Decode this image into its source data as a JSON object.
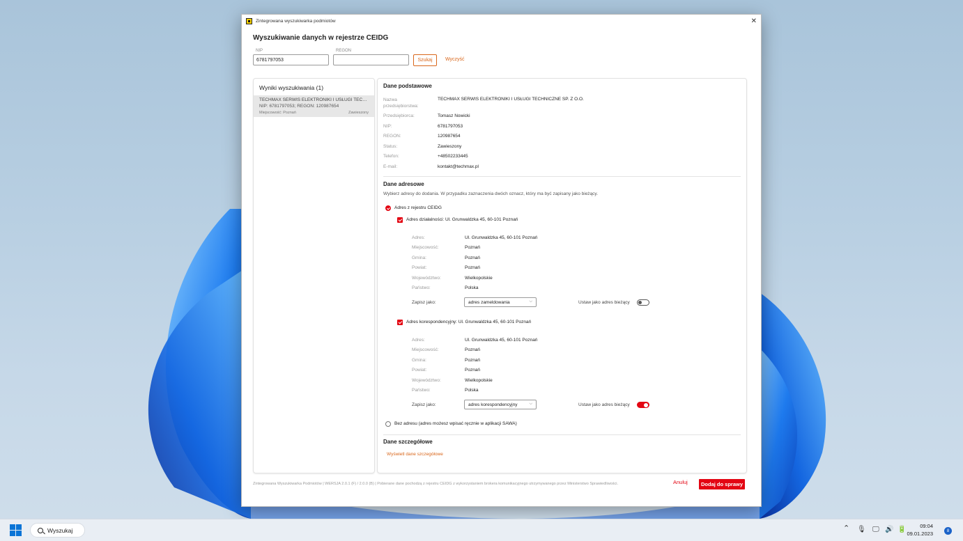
{
  "window": {
    "title": "Zintegrowana wyszukiwarka podmiotów",
    "close_glyph": "✕",
    "heading": "Wyszukiwanie danych w rejestrze CEIDG"
  },
  "search": {
    "nip_label": "NIP",
    "nip_value": "6781797053",
    "regon_label": "REGON",
    "regon_value": "",
    "search_button": "Szukaj",
    "clear_link": "Wyczyść"
  },
  "results": {
    "title": "Wyniki wyszukiwania (1)",
    "items": [
      {
        "name": "TECHMAX SERWIS ELEKTRONIKI I USŁUGI TECHNICZNE SP. Z O.O.",
        "ids": "NIP: 6781797053; REGON: 120987654",
        "city": "Miejscowość: Poznań",
        "status": "Zawieszony"
      }
    ]
  },
  "basic": {
    "title": "Dane podstawowe",
    "rows": [
      {
        "label": "Nazwa przedsiębiorstwa:",
        "value": "TECHMAX SERWIS ELEKTRONIKI I USŁUGI TECHNICZNE SP. Z O.O."
      },
      {
        "label": "Przedsiębiorca:",
        "value": "Tomasz Nowicki"
      },
      {
        "label": "NIP:",
        "value": "6781797053"
      },
      {
        "label": "REGON:",
        "value": "120987654"
      },
      {
        "label": "Status:",
        "value": "Zawieszony"
      },
      {
        "label": "Telefon:",
        "value": "+48502233445"
      },
      {
        "label": "E-mail:",
        "value": "kontakt@techmax.pl"
      }
    ]
  },
  "address": {
    "title": "Dane adresowe",
    "hint": "Wybierz adresy do dodania. W przypadku zaznaczenia dwóch oznacz, który ma być zapisany jako bieżący.",
    "option_registry": "Adres z rejestru CEIDG",
    "option_none": "Bez adresu (adres możesz wpisać ręcznie w aplikacji SAWA)",
    "save_as_label": "Zapisz jako:",
    "set_current_label": "Ustaw jako adres bieżący",
    "business": {
      "heading": "Adres działalności: Ul. Grunwaldzka 45, 60-101 Poznań",
      "rows": [
        {
          "label": "Adres:",
          "value": "Ul. Grunwaldzka 45, 60-101 Poznań"
        },
        {
          "label": "Miejscowość:",
          "value": "Poznań"
        },
        {
          "label": "Gmina:",
          "value": "Poznań"
        },
        {
          "label": "Powiat:",
          "value": "Poznań"
        },
        {
          "label": "Województwo:",
          "value": "Wielkopolskie"
        },
        {
          "label": "Państwo:",
          "value": "Polska"
        }
      ],
      "save_as": "adres zameldowania",
      "is_current": false
    },
    "correspondence": {
      "heading": "Adres korespondencyjny: Ul. Grunwaldzka 45, 60-101 Poznań",
      "rows": [
        {
          "label": "Adres:",
          "value": "Ul. Grunwaldzka 45, 60-101 Poznań"
        },
        {
          "label": "Miejscowość:",
          "value": "Poznań"
        },
        {
          "label": "Gmina:",
          "value": "Poznań"
        },
        {
          "label": "Powiat:",
          "value": "Poznań"
        },
        {
          "label": "Województwo:",
          "value": "Wielkopolskie"
        },
        {
          "label": "Państwo:",
          "value": "Polska"
        }
      ],
      "save_as": "adres korespondencyjny",
      "is_current": true
    }
  },
  "details": {
    "title": "Dane szczegółowe",
    "link": "Wyświetl dane szczegółowe"
  },
  "footer": {
    "info": "Zintegrowana Wyszukiwarka Podmiotów | WERSJA 2.0.1 (F) / 2.0.0 (B) | Pobierane dane pochodzą z rejestru CEIDG z wykorzystaniem brokera komunikacyjnego utrzymywanego przez Ministerstwo Sprawiedliwości.",
    "cancel": "Anuluj",
    "add": "Dodaj do sprawy"
  },
  "taskbar": {
    "search": "Wyszukaj",
    "time": "09:04",
    "date": "09.01.2023",
    "notifications": "8"
  },
  "colors": {
    "accent": "#e30613",
    "link": "#d9661a"
  }
}
